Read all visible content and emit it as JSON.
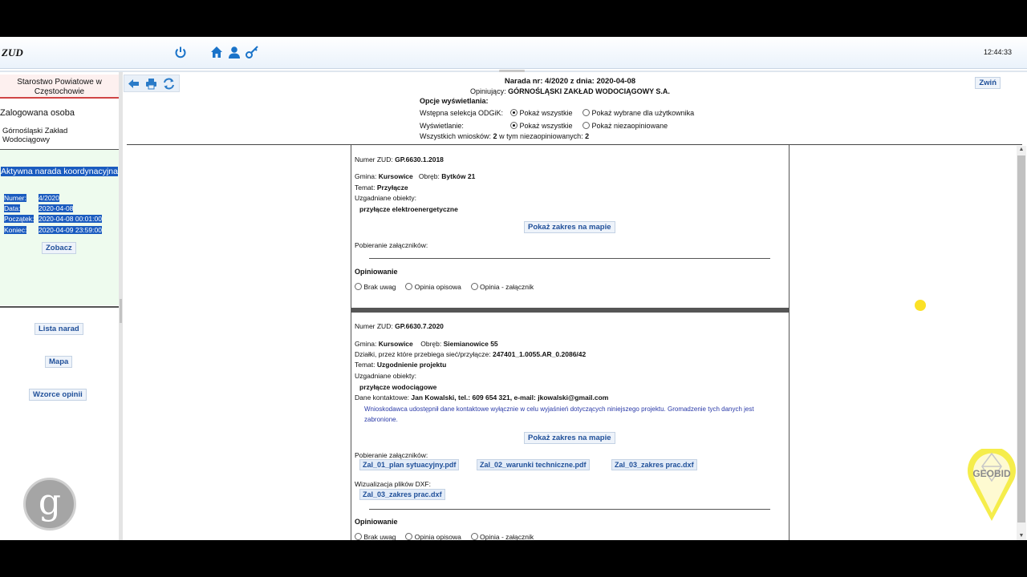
{
  "header": {
    "logo": "ZUD",
    "clock": "12:44:33",
    "icons": [
      "power-icon",
      "home-icon",
      "user-icon",
      "key-icon"
    ]
  },
  "sidebar": {
    "office": "Starostwo Powiatowe w Częstochowie",
    "logged_title": "Zalogowana osoba",
    "logged_name": "Górnośląski Zakład Wodociągowy",
    "active": {
      "title": "Aktywna narada koordynacyjna",
      "fields": [
        {
          "label": "Numer:",
          "value": "4/2020"
        },
        {
          "label": "Data:",
          "value": "2020-04-08"
        },
        {
          "label": "Początek:",
          "value": "2020-04-08 00:01:00"
        },
        {
          "label": "Koniec:",
          "value": "2020-04-09 23:59:00"
        }
      ],
      "view_button": "Zobacz"
    },
    "nav": [
      "Lista narad",
      "Mapa",
      "Wzorce opinii"
    ]
  },
  "toolbar": {
    "icons": [
      "back-icon",
      "print-icon",
      "refresh-icon"
    ],
    "collapse": "Zwiń"
  },
  "meeting": {
    "title": "Narada nr: 4/2020 z dnia: 2020-04-08",
    "reviewer_label": "Opiniujący:",
    "reviewer": "GÓRNOŚLĄSKI ZAKŁAD WODOCIĄGOWY S.A.",
    "options_title": "Opcje wyświetlania:",
    "selection_label": "Wstępna selekcja ODGiK:",
    "selection_options": [
      "Pokaż wszystkie",
      "Pokaż wybrane dla użytkownika"
    ],
    "display_label": "Wyświetlanie:",
    "display_options": [
      "Pokaż wszystkie",
      "Pokaż niezaopiniowane"
    ],
    "totals_text": "Wszystkich wniosków:",
    "total": "2",
    "unreviewed_text": "w tym niezaopiniowanych:",
    "unreviewed": "2"
  },
  "labels": {
    "zud_number": "Numer ZUD:",
    "gmina": "Gmina:",
    "obreb": "Obręb:",
    "temat": "Temat:",
    "objects": "Uzgadniane obiekty:",
    "map_button": "Pokaż zakres na mapie",
    "attachments": "Pobieranie załączników:",
    "opinion": "Opiniowanie",
    "opinion_options": [
      "Brak uwag",
      "Opinia opisowa",
      "Opinia - załącznik"
    ],
    "parcels": "Działki, przez które przebiega sieć/przyłącze:",
    "contact": "Dane kontaktowe:",
    "dxf": "Wizualizacja plików DXF:"
  },
  "applications": [
    {
      "zud": "GP.6630.1.2018",
      "gmina": "Kursowice",
      "obreb": "Bytków 21",
      "temat": "Przyłącze",
      "object": "przyłącze elektroenergetyczne"
    },
    {
      "zud": "GP.6630.7.2020",
      "gmina": "Kursowice",
      "obreb": "Siemianowice 55",
      "parcels": "247401_1.0055.AR_0.2086/42",
      "temat": "Uzgodnienie projektu",
      "object": "przyłącze wodociągowe",
      "contact": "Jan Kowalski, tel.: 609 654 321, e-mail: jkowalski@gmail.com",
      "notice": "Wnioskodawca udostępnił dane kontaktowe wyłącznie w celu wyjaśnień dotyczących niniejszego projektu. Gromadzenie tych danych jest zabronione.",
      "files": [
        "Zal_01_plan sytuacyjny.pdf",
        "Zal_02_warunki techniczne.pdf",
        "Zal_03_zakres prac.dxf"
      ],
      "dxf_files": [
        "Zal_03_zakres prac.dxf"
      ]
    }
  ],
  "watermark": {
    "brand": "GEOBID",
    "icon": "geobid-logo"
  }
}
